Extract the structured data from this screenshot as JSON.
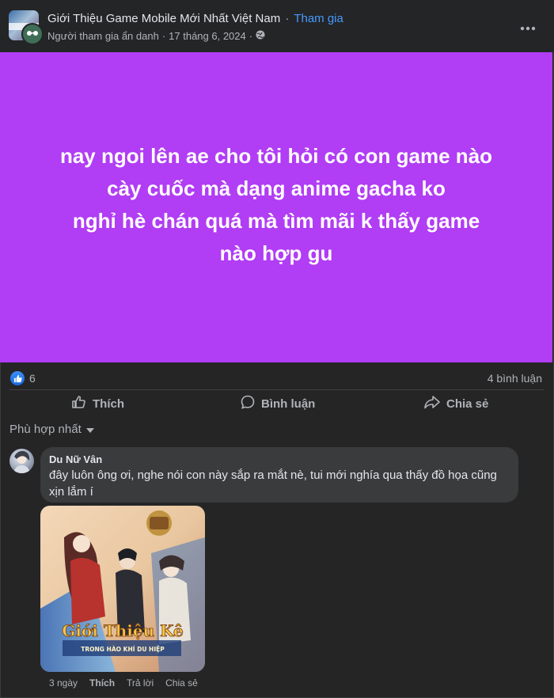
{
  "post": {
    "group_name": "Giới Thiệu Game Mobile Mới Nhất Việt Nam",
    "separator": "·",
    "join_label": "Tham gia",
    "author": "Người tham gia ẩn danh",
    "date": "17 tháng 6, 2024",
    "meta_separator": "·",
    "body": "nay ngoi lên ae cho tôi hỏi có con game nào\ncày cuốc mà dạng anime gacha ko\nnghỉ hè chán quá mà tìm mãi k thấy game\nnào hợp gu",
    "card_color": "#b13df4"
  },
  "reactions": {
    "like_count": "6",
    "comment_count": "4 bình luận"
  },
  "actions": {
    "like": "Thích",
    "comment": "Bình luận",
    "share": "Chia sẻ"
  },
  "sort": {
    "label": "Phù hợp nhất"
  },
  "comment": {
    "author": "Du Nữ Vân",
    "text": "đây luôn ông ơi, nghe nói con này sắp ra mắt nè, tui mới nghía qua thấy đồ họa cũng xịn lắm í",
    "image_title": "Giới Thiệu Kê",
    "image_subtitle": "TRONG HÀO KHÍ DU HIỆP",
    "time": "3 ngày",
    "like": "Thích",
    "reply": "Trả lời",
    "share": "Chia sẻ"
  },
  "icons": [
    "globe-icon",
    "more-icon",
    "like-icon",
    "comment-icon",
    "share-icon",
    "chevron-down-icon"
  ],
  "colors": {
    "accent": "#4599ff",
    "background": "#242526"
  }
}
